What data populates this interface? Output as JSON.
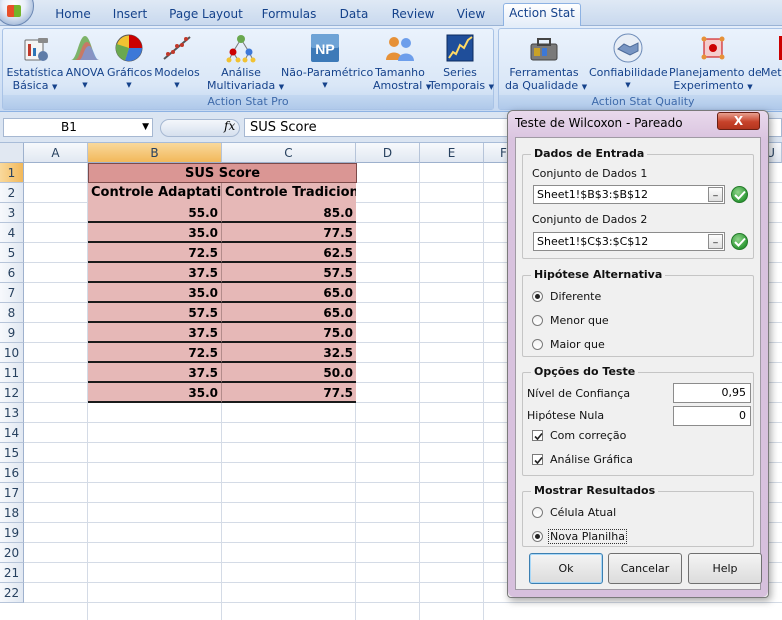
{
  "tabs": [
    "Home",
    "Insert",
    "Page Layout",
    "Formulas",
    "Data",
    "Review",
    "View",
    "Action Stat"
  ],
  "active_tab": "Action Stat",
  "ribbon": {
    "group_pro": {
      "label": "Action Stat Pro",
      "buttons": [
        {
          "line1": "Estatística",
          "line2": "Básica",
          "icon": "statistics-icon"
        },
        {
          "line1": "ANOVA",
          "line2": "",
          "icon": "anova-icon"
        },
        {
          "line1": "Gráficos",
          "line2": "",
          "icon": "pie-chart-icon"
        },
        {
          "line1": "Modelos",
          "line2": "",
          "icon": "models-icon"
        },
        {
          "line1": "Análise",
          "line2": "Multivariada",
          "icon": "multivariate-icon"
        },
        {
          "line1": "Não-Paramétrico",
          "line2": "",
          "icon": "np-icon"
        },
        {
          "line1": "Tamanho",
          "line2": "Amostral",
          "icon": "sample-size-icon"
        },
        {
          "line1": "Series",
          "line2": "Temporais",
          "icon": "time-series-icon"
        }
      ]
    },
    "group_quality": {
      "label": "Action Stat Quality",
      "buttons": [
        {
          "line1": "Ferramentas",
          "line2": "da Qualidade",
          "icon": "toolbox-icon"
        },
        {
          "line1": "Confiabilidade",
          "line2": "",
          "icon": "handshake-icon"
        },
        {
          "line1": "Planejamento de",
          "line2": "Experimento",
          "icon": "experiment-icon"
        },
        {
          "line1": "Metr",
          "line2": "",
          "icon": "metrology-icon"
        }
      ]
    }
  },
  "formula_bar": {
    "name_box": "B1",
    "fx": "fx",
    "formula": "SUS Score"
  },
  "grid": {
    "columns": [
      "A",
      "B",
      "C",
      "D",
      "E",
      "F",
      "U"
    ],
    "rows": [
      "1",
      "2",
      "3",
      "4",
      "5",
      "6",
      "7",
      "8",
      "9",
      "10",
      "11",
      "12",
      "13",
      "14",
      "15",
      "16",
      "17",
      "18",
      "19",
      "20",
      "21",
      "22"
    ],
    "title": "SUS Score",
    "header_b": "Controle Adaptativo",
    "header_c": "Controle Tradicional",
    "data": [
      [
        "55.0",
        "85.0"
      ],
      [
        "35.0",
        "77.5"
      ],
      [
        "72.5",
        "62.5"
      ],
      [
        "37.5",
        "57.5"
      ],
      [
        "35.0",
        "65.0"
      ],
      [
        "57.5",
        "65.0"
      ],
      [
        "37.5",
        "75.0"
      ],
      [
        "72.5",
        "32.5"
      ],
      [
        "37.5",
        "50.0"
      ],
      [
        "35.0",
        "77.5"
      ]
    ]
  },
  "dialog": {
    "title": "Teste de Wilcoxon - Pareado",
    "close": "X",
    "input_section": "Dados de Entrada",
    "ds1_label": "Conjunto de Dados 1",
    "ds1_value": "Sheet1!$B$3:$B$12",
    "ds2_label": "Conjunto de Dados 2",
    "ds2_value": "Sheet1!$C$3:$C$12",
    "ref_btn": "_",
    "alt_section": "Hipótese Alternativa",
    "alt_options": [
      "Diferente",
      "Menor que",
      "Maior que"
    ],
    "alt_selected": 0,
    "opt_section": "Opções do Teste",
    "conf_label": "Nível de Confiança",
    "conf_value": "0,95",
    "null_label": "Hipótese Nula",
    "null_value": "0",
    "cb_correction": "Com correção",
    "cb_graphic": "Análise Gráfica",
    "out_section": "Mostrar Resultados",
    "out_options": [
      "Célula Atual",
      "Nova Planilha"
    ],
    "out_selected": 1,
    "ok": "Ok",
    "cancel": "Cancelar",
    "help": "Help"
  }
}
